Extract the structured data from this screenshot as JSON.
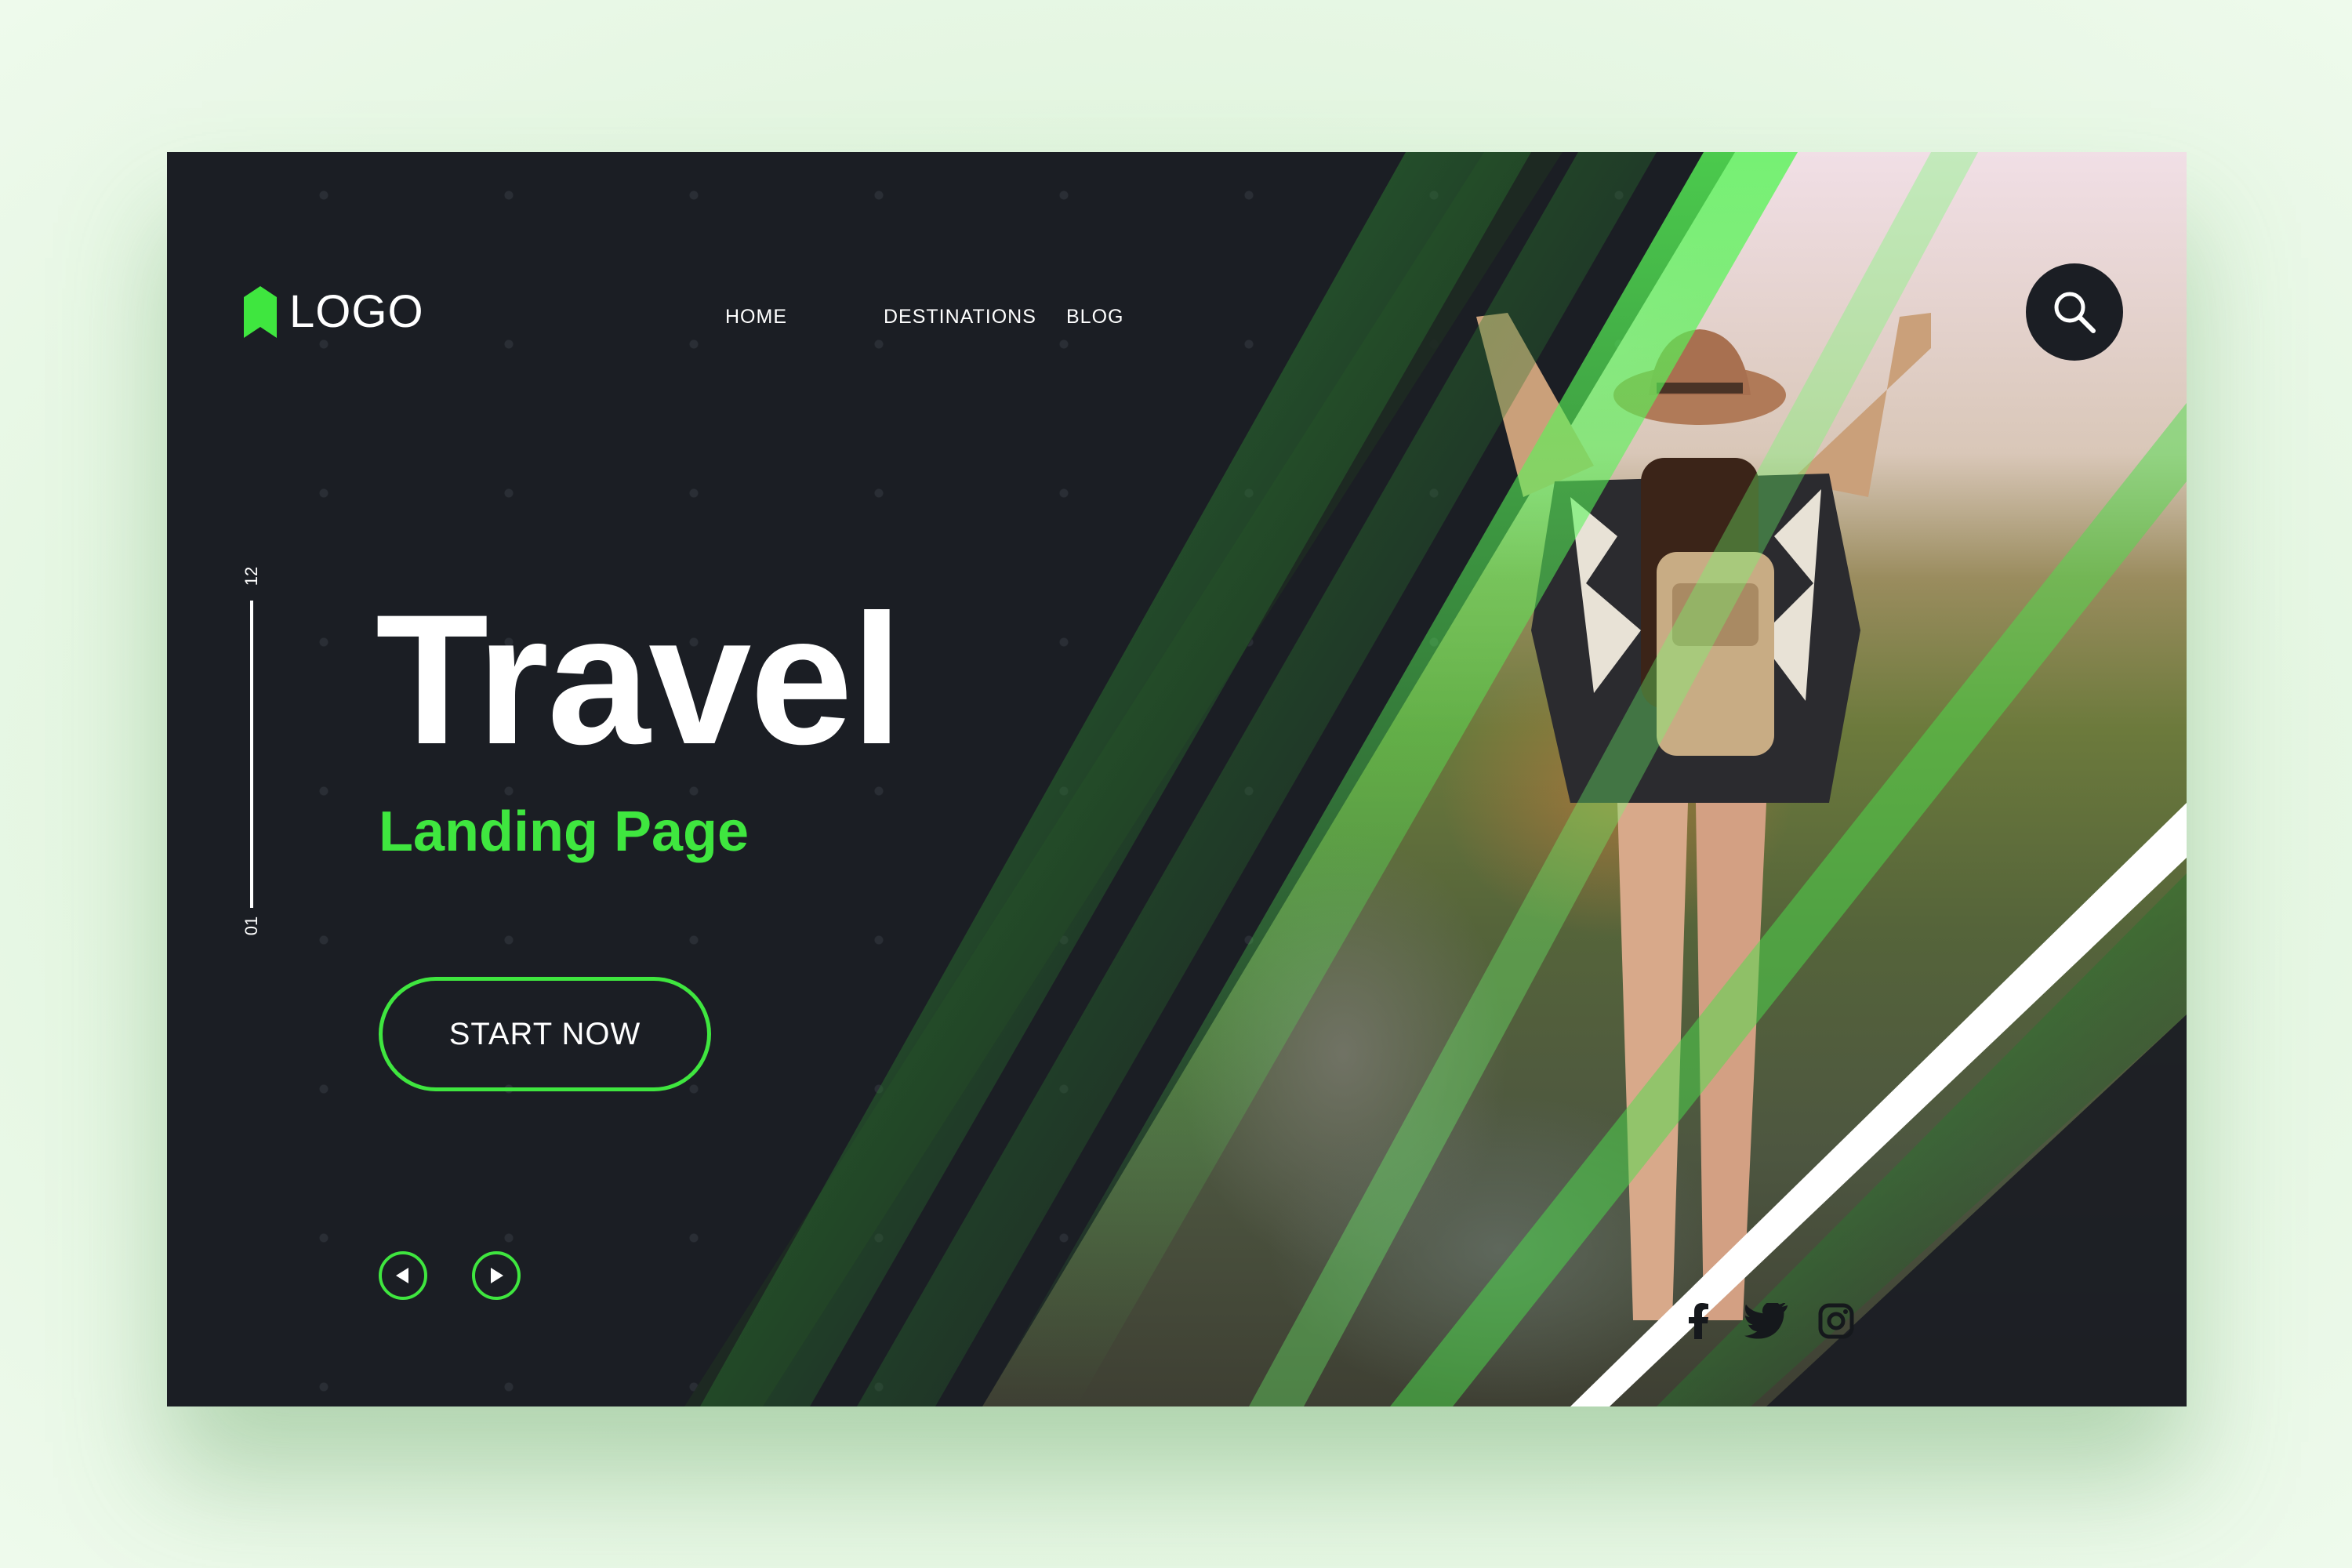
{
  "logo": {
    "text": "LOGO",
    "icon": "bookmark-logo-icon"
  },
  "nav": {
    "items": [
      "HOME",
      "DESTINATIONS",
      "BLOG"
    ]
  },
  "search": {
    "icon": "search-icon"
  },
  "slide": {
    "current": "01",
    "total": "12"
  },
  "hero": {
    "title": "Travel",
    "subtitle": "Landing Page",
    "cta_label": "START NOW"
  },
  "carousel": {
    "prev_icon": "triangle-left-icon",
    "next_icon": "triangle-right-icon"
  },
  "social": [
    "facebook-icon",
    "twitter-icon",
    "instagram-icon"
  ],
  "colors": {
    "background": "#1b1e24",
    "accent": "#3fe63f",
    "page": "#e2f5df"
  }
}
